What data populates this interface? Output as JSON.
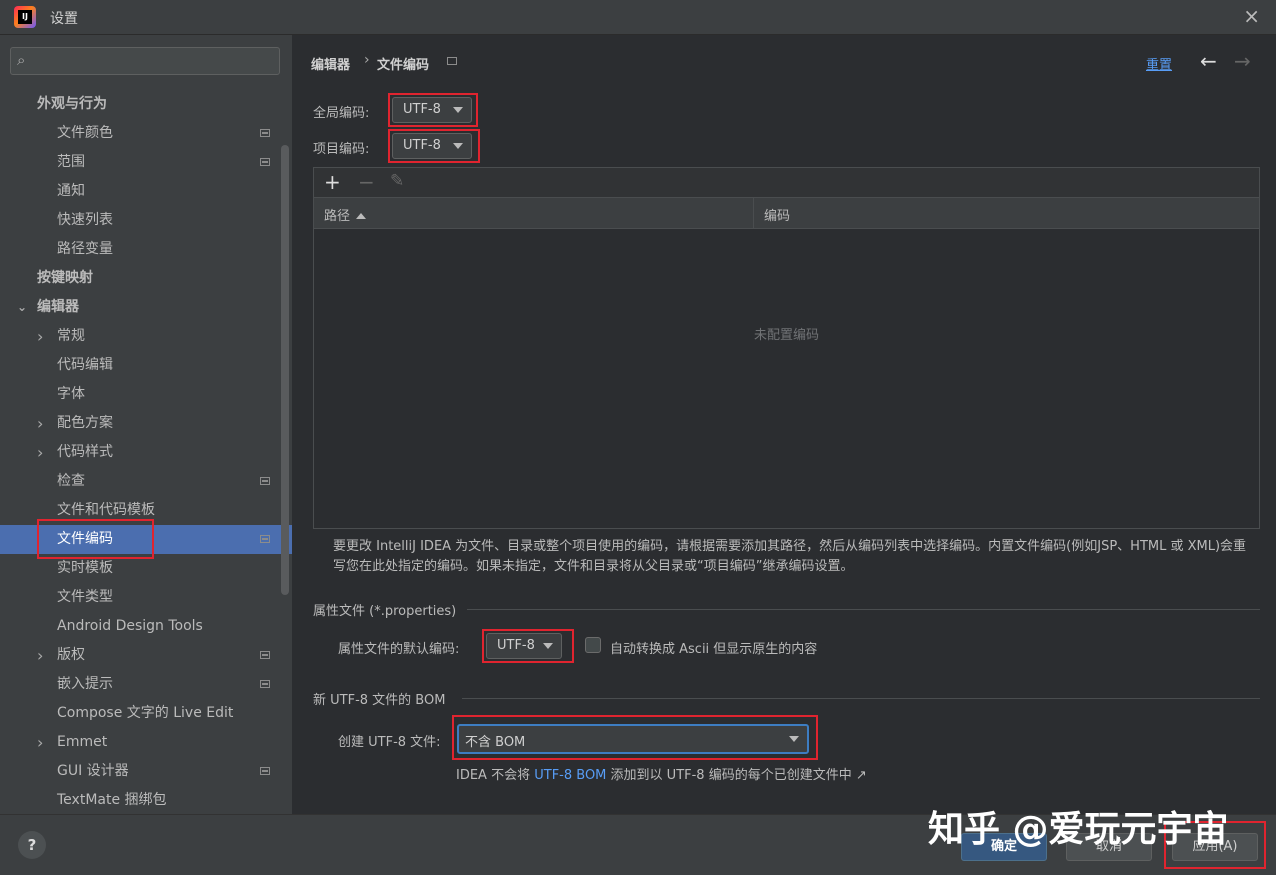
{
  "window": {
    "title": "设置",
    "close_icon": "×"
  },
  "sidebar": {
    "search_placeholder": "",
    "items": [
      {
        "label": "外观与行为",
        "level": 0
      },
      {
        "label": "文件颜色",
        "level": 1,
        "project": true
      },
      {
        "label": "范围",
        "level": 1,
        "project": true
      },
      {
        "label": "通知",
        "level": 1
      },
      {
        "label": "快速列表",
        "level": 1
      },
      {
        "label": "路径变量",
        "level": 1
      },
      {
        "label": "按键映射",
        "level": 0
      },
      {
        "label": "编辑器",
        "level": 0,
        "expanded": true
      },
      {
        "label": "常规",
        "level": 1,
        "collapsed": true
      },
      {
        "label": "代码编辑",
        "level": 1
      },
      {
        "label": "字体",
        "level": 1
      },
      {
        "label": "配色方案",
        "level": 1,
        "collapsed": true
      },
      {
        "label": "代码样式",
        "level": 1,
        "collapsed": true
      },
      {
        "label": "检查",
        "level": 1,
        "project": true
      },
      {
        "label": "文件和代码模板",
        "level": 1
      },
      {
        "label": "文件编码",
        "level": 1,
        "project": true,
        "selected": true
      },
      {
        "label": "实时模板",
        "level": 1
      },
      {
        "label": "文件类型",
        "level": 1
      },
      {
        "label": "Android Design Tools",
        "level": 1
      },
      {
        "label": "版权",
        "level": 1,
        "collapsed": true,
        "project": true
      },
      {
        "label": "嵌入提示",
        "level": 1,
        "project": true
      },
      {
        "label": "Compose 文字的 Live Edit",
        "level": 1
      },
      {
        "label": "Emmet",
        "level": 1,
        "collapsed": true
      },
      {
        "label": "GUI 设计器",
        "level": 1,
        "project": true
      },
      {
        "label": "TextMate 捆绑包",
        "level": 1
      }
    ]
  },
  "breadcrumb": {
    "parent": "编辑器",
    "current": "文件编码"
  },
  "header": {
    "reset_label": "重置",
    "back_icon": "←",
    "forward_icon": "→"
  },
  "global_encoding": {
    "label": "全局编码:",
    "value": "UTF-8"
  },
  "project_encoding": {
    "label": "项目编码:",
    "value": "UTF-8"
  },
  "table": {
    "toolbar": {
      "add": "+",
      "remove": "−",
      "edit": "✎"
    },
    "columns": [
      "路径",
      "编码"
    ],
    "empty_text": "未配置编码"
  },
  "description": "要更改 IntelliJ IDEA 为文件、目录或整个项目使用的编码，请根据需要添加其路径，然后从编码列表中选择编码。内置文件编码(例如JSP、HTML 或 XML)会重写您在此处指定的编码。如果未指定，文件和目录将从父目录或“项目编码”继承编码设置。",
  "properties": {
    "section_title": "属性文件 (*.properties)",
    "default_label": "属性文件的默认编码:",
    "default_value": "UTF-8",
    "checkbox_label": "自动转换成 Ascii 但显示原生的内容",
    "checkbox_checked": false
  },
  "bom": {
    "section_title": "新 UTF-8 文件的 BOM",
    "create_label": "创建 UTF-8 文件:",
    "create_value": "不含 BOM",
    "hint_prefix": "IDEA 不会将",
    "hint_link": "UTF-8 BOM",
    "hint_suffix": "添加到以 UTF-8 编码的每个已创建文件中 ↗"
  },
  "buttons": {
    "help": "?",
    "ok": "确定",
    "cancel": "取消",
    "apply": "应用(A)"
  },
  "watermark": "知乎 @爱玩元宇宙",
  "colors": {
    "accent": "#4b6eaf",
    "link": "#589df6",
    "highlight": "#e0242f",
    "ok_button": "#365880"
  }
}
